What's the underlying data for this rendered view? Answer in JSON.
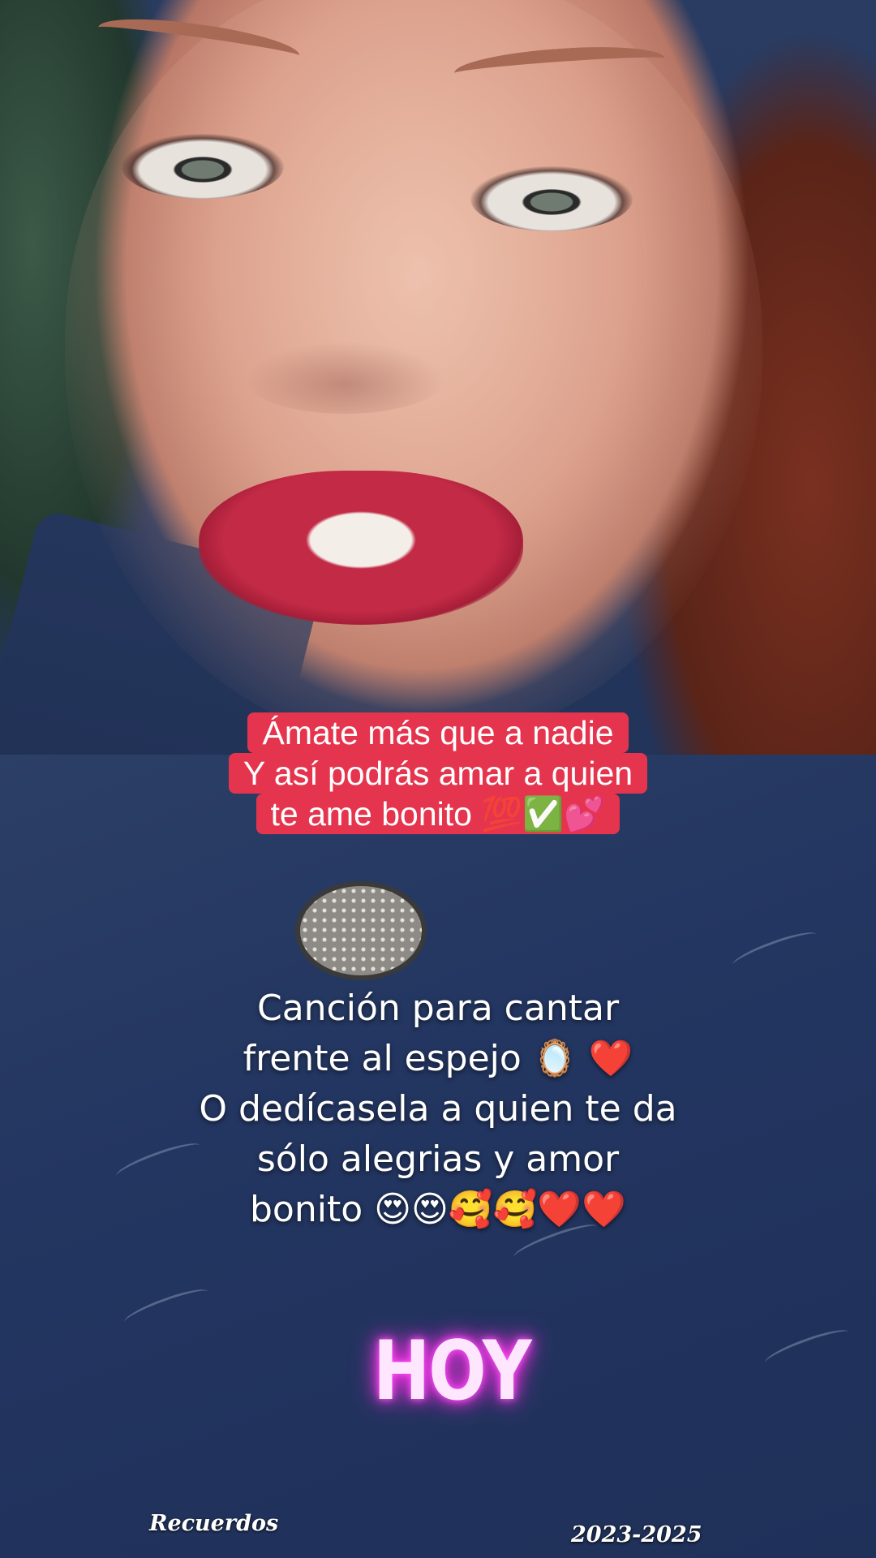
{
  "caption_top": {
    "lines": [
      "Ámate más que a nadie",
      "Y así podrás amar a quien",
      "te ame bonito 💯✅💕"
    ]
  },
  "caption_middle": {
    "lines": [
      "Canción para cantar",
      "frente al espejo 🪞 ❤️",
      "O dedícasela a quien te da",
      "sólo alegrias y amor",
      "bonito 😍😍🥰🥰❤️❤️"
    ]
  },
  "sticker": {
    "text": "HOY"
  },
  "footer": {
    "left": "Recuerdos",
    "right": "2023-2025"
  }
}
